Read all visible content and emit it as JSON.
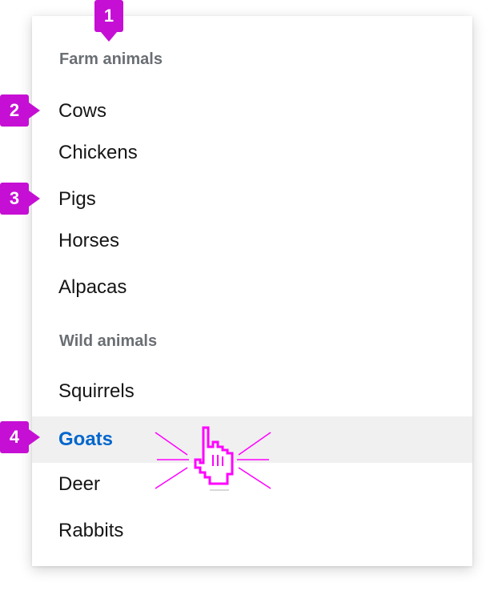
{
  "menu": {
    "groups": [
      {
        "title": "Farm animals",
        "items": [
          "Cows",
          "Chickens",
          "Pigs",
          "Horses",
          "Alpacas"
        ]
      },
      {
        "title": "Wild animals",
        "items": [
          "Squirrels",
          "Goats",
          "Deer",
          "Rabbits"
        ]
      }
    ],
    "hovered_item": "Goats"
  },
  "callouts": [
    "1",
    "2",
    "3",
    "4"
  ],
  "colors": {
    "callout": "#c50fd4",
    "hover_background": "#f0f0f0",
    "hover_text": "#0066cc",
    "group_title": "#6a6e73",
    "item_text": "#151515",
    "cursor_highlight": "#ff00ff"
  },
  "icons": {
    "cursor": "hand-pointer-cursor-icon"
  }
}
